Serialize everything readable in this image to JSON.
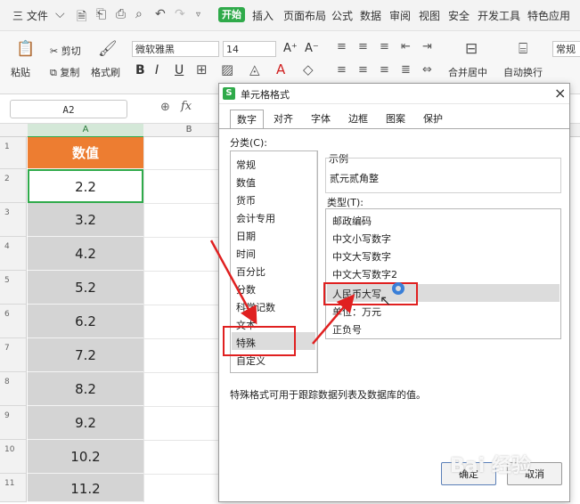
{
  "menubar": {
    "file": "三 文件",
    "items": [
      "开始",
      "插入",
      "页面布局",
      "公式",
      "数据",
      "审阅",
      "视图",
      "安全",
      "开发工具",
      "特色应用"
    ]
  },
  "ribbon": {
    "paste": "粘贴",
    "cut": "剪切",
    "copy": "复制",
    "format_painter": "格式刷",
    "font_name": "微软雅黑",
    "font_size": "14",
    "font_grow": "A⁺",
    "font_shrink": "A⁻",
    "bold": "B",
    "italic": "I",
    "underline": "U",
    "merge_center": "合并居中",
    "wrap_text": "自动换行",
    "number_format": "常规"
  },
  "formula_bar": {
    "name_box": "A2",
    "fx": "fx"
  },
  "sheet": {
    "columns": [
      "A",
      "B"
    ],
    "header_cell": "数值",
    "header_color": "#ed7d31",
    "rows": [
      {
        "row": "1",
        "value": "数值"
      },
      {
        "row": "2",
        "value": "2.2"
      },
      {
        "row": "3",
        "value": "3.2"
      },
      {
        "row": "4",
        "value": "4.2"
      },
      {
        "row": "5",
        "value": "5.2"
      },
      {
        "row": "6",
        "value": "6.2"
      },
      {
        "row": "7",
        "value": "7.2"
      },
      {
        "row": "8",
        "value": "8.2"
      },
      {
        "row": "9",
        "value": "9.2"
      },
      {
        "row": "10",
        "value": "10.2"
      },
      {
        "row": "11",
        "value": "11.2"
      }
    ]
  },
  "dialog": {
    "title": "单元格格式",
    "close": "×",
    "tabs": [
      "数字",
      "对齐",
      "字体",
      "边框",
      "图案",
      "保护"
    ],
    "category_label": "分类(C):",
    "categories": [
      "常规",
      "数值",
      "货币",
      "会计专用",
      "日期",
      "时间",
      "百分比",
      "分数",
      "科学记数",
      "文本",
      "特殊",
      "自定义"
    ],
    "selected_category": "特殊",
    "sample_label": "示例",
    "sample_value": "贰元贰角整",
    "type_label": "类型(T):",
    "types": [
      "邮政编码",
      "中文小写数字",
      "中文大写数字",
      "中文大写数字2",
      "人民币大写",
      "单位：万元",
      "正负号"
    ],
    "selected_type": "人民币大写",
    "description": "特殊格式可用于跟踪数据列表及数据库的值。",
    "ok": "确定",
    "cancel": "取消",
    "accent": "#e02020"
  }
}
